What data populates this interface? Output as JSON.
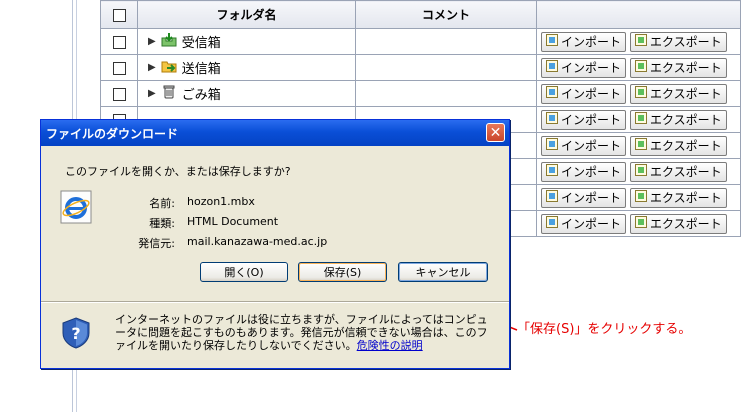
{
  "table": {
    "header": {
      "name": "フォルダ名",
      "comment": "コメント"
    },
    "import_label": "インポート",
    "export_label": "エクスポート",
    "rows": [
      {
        "name": "受信箱",
        "icon": "inbox-icon"
      },
      {
        "name": "送信箱",
        "icon": "outbox-icon"
      },
      {
        "name": "ごみ箱",
        "icon": "trash-icon"
      },
      {
        "name": "",
        "icon": ""
      },
      {
        "name": "",
        "icon": ""
      },
      {
        "name": "",
        "icon": ""
      },
      {
        "name": "",
        "icon": ""
      },
      {
        "name": "",
        "icon": ""
      }
    ]
  },
  "dialog": {
    "title": "ファイルのダウンロード",
    "question": "このファイルを開くか、または保存しますか?",
    "name_label": "名前:",
    "name_value": "hozon1.mbx",
    "type_label": "種類:",
    "type_value": "HTML Document",
    "from_label": "発信元:",
    "from_value": "mail.kanazawa-med.ac.jp",
    "open_btn": "開く(O)",
    "save_btn": "保存(S)",
    "cancel_btn": "キャンセル",
    "warning": "インターネットのファイルは役に立ちますが、ファイルによってはコンピュータに問題を起こすものもあります。発信元が信頼できない場合は、このファイルを開いたり保存したりしないでください。",
    "risk_link": "危険性の説明"
  },
  "annotation": "「保存(S)」をクリックする。",
  "colors": {
    "titlebar": "#0a4fd7",
    "annotation": "#e60000",
    "dialog_bg": "#ece9d8"
  }
}
